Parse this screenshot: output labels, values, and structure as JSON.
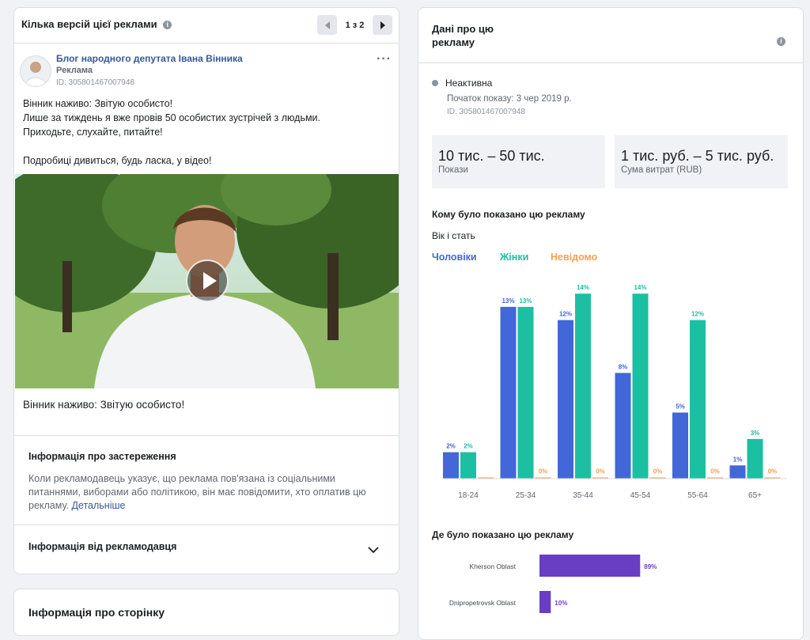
{
  "colors": {
    "men": "#4267d8",
    "women": "#1cbfa1",
    "unknown": "#f5a05a",
    "region": "#6a3ec2"
  },
  "left": {
    "versions_title": "Кілька версій цієї реклами",
    "pager": "1 з 2",
    "ad": {
      "advertiser": "Блог народного депутата Івана Вінника",
      "sponsored": "Реклама",
      "id": "ID: 305801467007948",
      "lines": [
        "Вінник наживо: Звітую особисто!",
        "Лише за тиждень я вже провів 50 особистих зустрічей з людьми.",
        "Приходьте, слухайте, питайте!",
        "Подробиці дивиться, будь ласка, у відео!"
      ],
      "caption": "Вінник наживо: Звітую особисто!"
    },
    "disclaimer_title": "Інформація про застереження",
    "disclaimer_text": "Коли рекламодавець указує, що реклама пов'язана із соціальними питаннями, виборами або політикою, він має повідомити, хто оплатив цю рекламу.",
    "disclaimer_link": "Детальніше",
    "advertiser_info": "Інформація від рекламодавця",
    "page_info": "Інформація про сторінку"
  },
  "right": {
    "title_line1": "Дані про цю",
    "title_line2": "рекламу",
    "status": "Неактивна",
    "start": "Початок показу: 3 чер 2019 р.",
    "id": "ID: 305801467007948",
    "impressions_value": "10 тис. – 50 тис.",
    "impressions_label": "Покази",
    "spend_value": "1 тис. руб. – 5 тис. руб.",
    "spend_label": "Сума витрат (RUB)",
    "audience_title": "Кому було показано цю рекламу",
    "age_gender": "Вік і стать",
    "legend_men": "Чоловіки",
    "legend_women": "Жінки",
    "legend_unknown": "Невідомо",
    "regions_title": "Де було показано цю рекламу"
  },
  "chart_data": [
    {
      "type": "bar",
      "categories": [
        "18-24",
        "25-34",
        "35-44",
        "45-54",
        "55-64",
        "65+"
      ],
      "series": [
        {
          "name": "Чоловіки",
          "values": [
            2,
            13,
            12,
            null,
            5,
            1
          ],
          "labels": [
            "2%",
            "13%",
            "12%",
            "8%",
            "5%",
            "1%"
          ],
          "bar_values": [
            2,
            13,
            12,
            8,
            5,
            1
          ]
        },
        {
          "name": "Жінки",
          "values": [
            2,
            13,
            14,
            14,
            12,
            3
          ],
          "labels": [
            "2%",
            "13%",
            "14%",
            "14%",
            "12%",
            "3%"
          ]
        },
        {
          "name": "Невідомо",
          "values": [
            0,
            0,
            0,
            0,
            0,
            0
          ],
          "labels": [
            "",
            "0%",
            "0%",
            "0%",
            "0%",
            "0%"
          ]
        }
      ],
      "ylim": [
        0,
        14
      ]
    },
    {
      "type": "bar",
      "categories": [
        "Kherson Oblast",
        "Dnipropetrovsk Oblast"
      ],
      "values": [
        89,
        10
      ],
      "labels": [
        "89%",
        "10%"
      ],
      "xlim": [
        0,
        100
      ]
    }
  ]
}
